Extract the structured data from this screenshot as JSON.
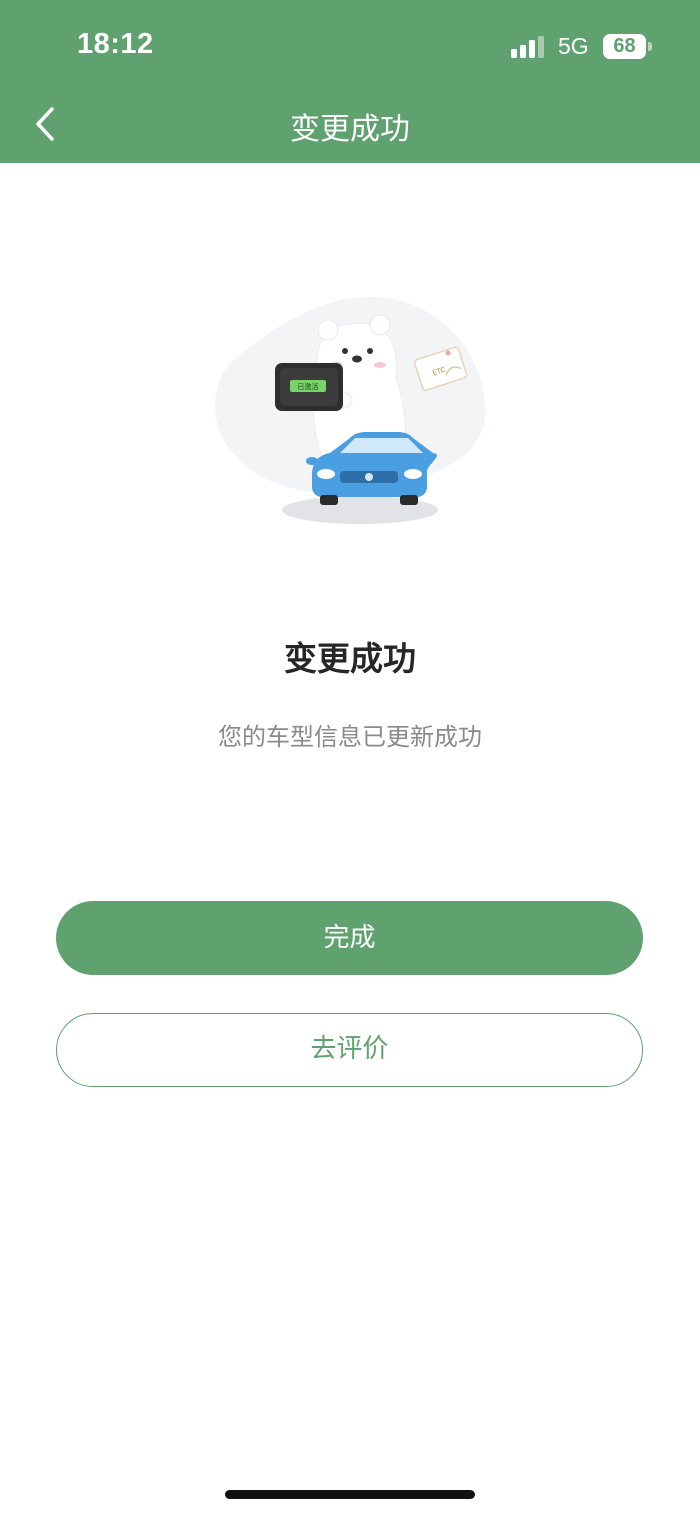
{
  "status_bar": {
    "time": "18:12",
    "network": "5G",
    "battery_level": "68",
    "signal_icon": "signal-bars-icon"
  },
  "nav": {
    "back_icon": "chevron-left-icon",
    "title": "变更成功"
  },
  "illustration": {
    "device_screen_text": "已激活",
    "card_text": "ETC"
  },
  "result": {
    "title": "变更成功",
    "description": "您的车型信息已更新成功"
  },
  "buttons": {
    "done_label": "完成",
    "review_label": "去评价"
  },
  "colors": {
    "primary": "#5fa26f",
    "title_text": "#262626",
    "secondary_text": "#8a8a8a",
    "car_blue": "#4a9fe0"
  }
}
